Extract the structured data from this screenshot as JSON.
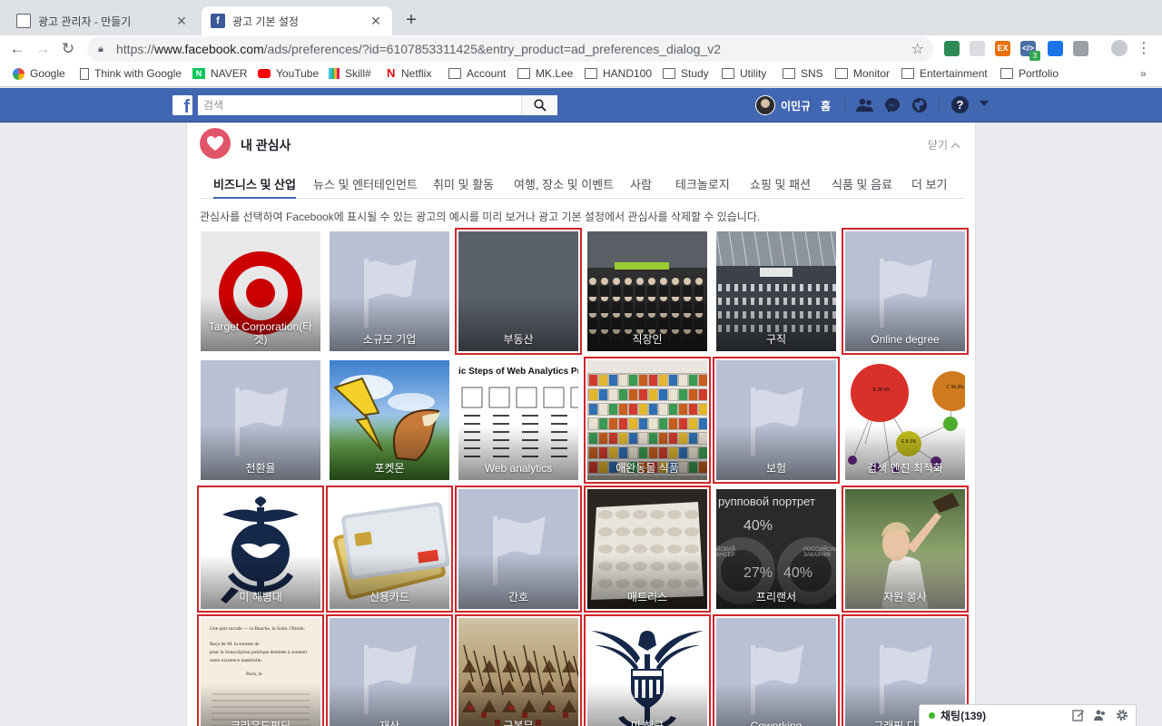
{
  "browser": {
    "tabs": [
      {
        "title": "광고 관리자 - 만들기",
        "active": false
      },
      {
        "title": "광고 기본 설정",
        "active": true
      }
    ],
    "url_scheme": "https://",
    "url_host": "www.facebook.com",
    "url_path": "/ads/preferences/?id=6107853311425&entry_product=ad_preferences_dialog_v2",
    "extension_badge": "3",
    "bookmarks": [
      "Google",
      "Think with Google",
      "NAVER",
      "YouTube",
      "Skill#",
      "Netflix",
      "Account",
      "MK.Lee",
      "HAND100",
      "Study",
      "Utility",
      "SNS",
      "Monitor",
      "Entertainment",
      "Portfolio"
    ],
    "bookmarks_more": "»"
  },
  "facebook": {
    "search_placeholder": "검색",
    "user_name": "이민규",
    "home_label": "홈",
    "help_glyph": "?"
  },
  "card": {
    "title": "내 관심사",
    "close_label": "닫기",
    "tabs": [
      "비즈니스 및 산업",
      "뉴스 및 엔터테인먼트",
      "취미 및 활동",
      "여행, 장소 및 이벤트",
      "사람",
      "테크놀로지",
      "쇼핑 및 패션",
      "식품 및 음료",
      "더 보기"
    ],
    "active_tab": "비즈니스 및 산업",
    "description": "관심사를 선택하여 Facebook에 표시될 수 있는 광고의 예시를 미리 보거나 광고 기본 설정에서 관심사를 삭제할 수 있습니다.",
    "tiles": [
      {
        "label": "Target Corporation(타겟)",
        "art": "target",
        "selected": false
      },
      {
        "label": "소규모 기업",
        "art": "flag",
        "selected": false
      },
      {
        "label": "부동산",
        "art": "slate",
        "selected": true
      },
      {
        "label": "직장인",
        "art": "crowd",
        "selected": false
      },
      {
        "label": "구직",
        "art": "hall",
        "selected": false
      },
      {
        "label": "Online degree",
        "art": "flag",
        "selected": true
      },
      {
        "label": "전환율",
        "art": "flag",
        "selected": false
      },
      {
        "label": "포켓몬",
        "art": "pokemon",
        "selected": false
      },
      {
        "label": "Web analytics",
        "art": "webanalytics",
        "selected": false
      },
      {
        "label": "애완동물 식품",
        "art": "shelves",
        "selected": true
      },
      {
        "label": "보험",
        "art": "flag",
        "selected": true
      },
      {
        "label": "검색 엔진 최적화",
        "art": "bubbles",
        "selected": false
      },
      {
        "label": "미 해병대",
        "art": "marines",
        "selected": true
      },
      {
        "label": "신용카드",
        "art": "cards",
        "selected": true
      },
      {
        "label": "간호",
        "art": "flag",
        "selected": true
      },
      {
        "label": "매트리스",
        "art": "mattress",
        "selected": true
      },
      {
        "label": "프리랜서",
        "art": "russian",
        "selected": false
      },
      {
        "label": "자원 봉사",
        "art": "woman",
        "selected": true
      },
      {
        "label": "크라우드펀딩",
        "art": "document",
        "selected": true
      },
      {
        "label": "재산",
        "art": "flag",
        "selected": true
      },
      {
        "label": "군복무",
        "art": "battle",
        "selected": true
      },
      {
        "label": "미 해군",
        "art": "navy",
        "selected": true
      },
      {
        "label": "Coworking",
        "art": "flag",
        "selected": true
      },
      {
        "label": "그래픽 디자인",
        "art": "flag",
        "selected": true
      }
    ],
    "art_text": {
      "web_analytics_heading": "ic Steps of Web Analytics Proce",
      "russian_heading": "рупповой портрет",
      "russian_pct1": "40%",
      "russian_pct2": "27%",
      "russian_pct3": "40%",
      "russian_side1": "ЙСКИЙ АНСЕР",
      "russian_side2": "РОССИЙСКИ ЗАКАЗЧИК",
      "bubble_b": "B 28.4%",
      "bubble_c": "C 34.3%",
      "bubble_e": "E 8.1%",
      "doc_line1": "Une part sociale — la Banche, la Suite, l'Etoile.",
      "doc_line2": "Reçu de M. la somme de",
      "doc_line3": "pour la Souscription publique destinée à soutenir notre existence matérielle.",
      "doc_line4": "Paris, le"
    }
  },
  "chat": {
    "label": "채팅(139)"
  }
}
